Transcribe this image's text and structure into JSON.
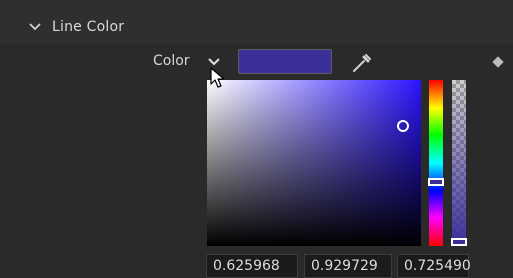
{
  "section": {
    "title": "Line Color",
    "expanded": true
  },
  "color_row": {
    "label": "Color",
    "swatch_color": "#3b2f9a"
  },
  "picker": {
    "hue_color": "#2a14ff",
    "selected_color": "#3b2f9a",
    "values": [
      "0.625968",
      "0.929729",
      "0.725490"
    ]
  },
  "icons": {
    "collapse": "chevron-down-icon",
    "dropdown": "chevron-down-icon",
    "eyedropper": "eyedropper-icon",
    "keyframe": "diamond-icon",
    "cursor": "mouse-pointer-icon"
  }
}
